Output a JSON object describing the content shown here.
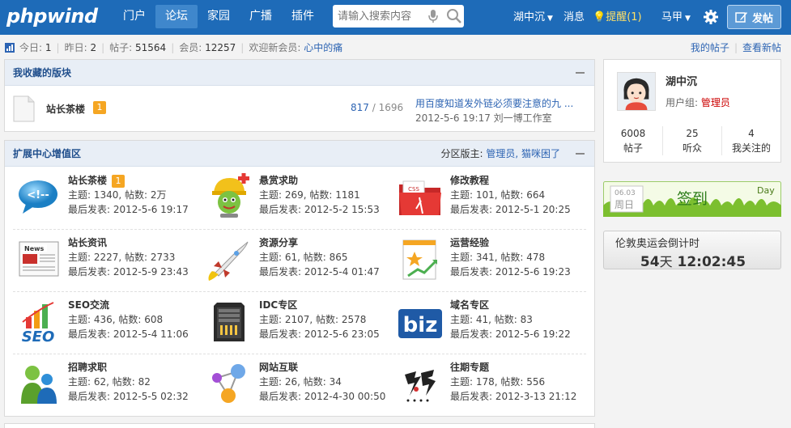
{
  "header": {
    "logo": "phpwind",
    "nav": [
      "门户",
      "论坛",
      "家园",
      "广播",
      "插件"
    ],
    "nav_active": 1,
    "search_placeholder": "请输入搜索内容",
    "user_name": "湖中沉",
    "messages": "消息",
    "remind_label": "提醒",
    "remind_count": "(1)",
    "other_user": "马甲",
    "post_button": "发帖"
  },
  "stats": {
    "today_label": "今日:",
    "today": "1",
    "yesterday_label": "昨日:",
    "yesterday": "2",
    "threads_label": "帖子:",
    "threads": "51564",
    "members_label": "会员:",
    "members": "12257",
    "welcome_label": "欢迎新会员:",
    "new_member": "心中的痛",
    "my_threads": "我的帖子",
    "new_threads": "查看新帖"
  },
  "favorites": {
    "title": "我收藏的版块",
    "forum": {
      "name": "站长茶楼",
      "badge": "1",
      "today_count": "817",
      "separator": "/",
      "total_count": "1696",
      "last_title": "用百度知道发外链必须要注意的九 ...",
      "last_meta": "2012-5-6 19:17 刘一博工作室"
    }
  },
  "zone": {
    "title": "扩展中心增值区",
    "moderators_label": "分区版主:",
    "moderators": "管理员, 猫咪困了",
    "forums": [
      {
        "name": "站长茶楼",
        "badge": "1",
        "stats": "主题: 1340, 帖数: 2万",
        "last": "最后发表: 2012-5-6 19:17",
        "icon": "chat-bubble-icon"
      },
      {
        "name": "悬赏求助",
        "badge": "",
        "stats": "主题: 269, 帖数: 1181",
        "last": "最后发表: 2012-5-2 15:53",
        "icon": "help-mascot-icon"
      },
      {
        "name": "修改教程",
        "badge": "",
        "stats": "主题: 101, 帖数: 664",
        "last": "最后发表: 2012-5-1 20:25",
        "icon": "css-folder-icon"
      },
      {
        "name": "站长资讯",
        "badge": "",
        "stats": "主题: 2227, 帖数: 2733",
        "last": "最后发表: 2012-5-9 23:43",
        "icon": "newspaper-icon"
      },
      {
        "name": "资源分享",
        "badge": "",
        "stats": "主题: 61, 帖数: 865",
        "last": "最后发表: 2012-5-4 01:47",
        "icon": "rocket-icon"
      },
      {
        "name": "运营经验",
        "badge": "",
        "stats": "主题: 341, 帖数: 478",
        "last": "最后发表: 2012-5-6 19:23",
        "icon": "growth-chart-icon"
      },
      {
        "name": "SEO交流",
        "badge": "",
        "stats": "主题: 436, 帖数: 608",
        "last": "最后发表: 2012-5-4 11:06",
        "icon": "seo-bars-icon"
      },
      {
        "name": "IDC专区",
        "badge": "",
        "stats": "主题: 2107, 帖数: 2578",
        "last": "最后发表: 2012-5-6 23:05",
        "icon": "server-rack-icon"
      },
      {
        "name": "域名专区",
        "badge": "",
        "stats": "主题: 41, 帖数: 83",
        "last": "最后发表: 2012-5-6 19:22",
        "icon": "biz-domain-icon"
      },
      {
        "name": "招聘求职",
        "badge": "",
        "stats": "主题: 62, 帖数: 82",
        "last": "最后发表: 2012-5-5 02:32",
        "icon": "people-icon"
      },
      {
        "name": "网站互联",
        "badge": "",
        "stats": "主题: 26, 帖数: 34",
        "last": "最后发表: 2012-4-30 00:50",
        "icon": "network-nodes-icon"
      },
      {
        "name": "往期专题",
        "badge": "",
        "stats": "主题: 178, 帖数: 556",
        "last": "最后发表: 2012-3-13 21:12",
        "icon": "focus-logo-icon"
      }
    ]
  },
  "profile": {
    "name": "湖中沉",
    "group_label": "用户组:",
    "group": "管理员",
    "posts": "6008",
    "posts_label": "帖子",
    "fans": "25",
    "fans_label": "听众",
    "following": "4",
    "following_label": "我关注的"
  },
  "signin": {
    "date": "06.03",
    "weekday": "周日",
    "label": "签到",
    "day": "Day"
  },
  "countdown": {
    "title": "伦敦奥运会倒计时",
    "days": "54",
    "days_unit": "天",
    "time": "12:02:45"
  },
  "colors": {
    "topbar": "#1e6bb8",
    "link": "#2d64b3",
    "badge": "#f5a623",
    "admin_red": "#cc0000"
  }
}
